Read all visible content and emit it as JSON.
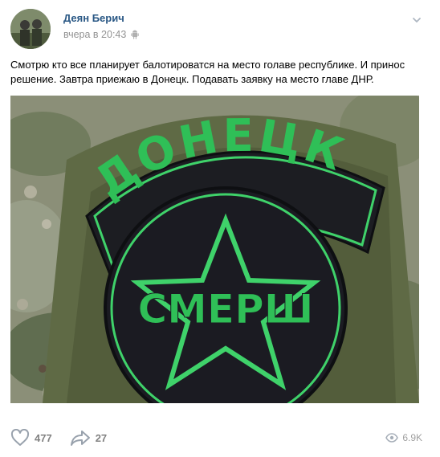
{
  "post": {
    "author": "Деян Берич",
    "timestamp": "вчера в 20:43",
    "text": "Смотрю кто все планирует балотироватся на место голаве республике. И принос решение. Завтра приежаю в Донецк. Подавать заявку на место главе ДНР.",
    "image": {
      "patch_top_text": "ДОНЕЦК",
      "patch_bottom_text": "СМЕРШ"
    }
  },
  "footer": {
    "likes": "477",
    "shares": "27",
    "views": "6.9K"
  },
  "icons": {
    "like": "heart-icon",
    "share": "share-arrow-icon",
    "views": "eye-icon",
    "more": "more-icon",
    "platform": "android-icon"
  },
  "colors": {
    "author_link": "#2a5885",
    "meta_gray": "#939393",
    "action_gray": "#828282",
    "patch_green": "#3fd26a",
    "patch_dark": "#1b1b22"
  }
}
